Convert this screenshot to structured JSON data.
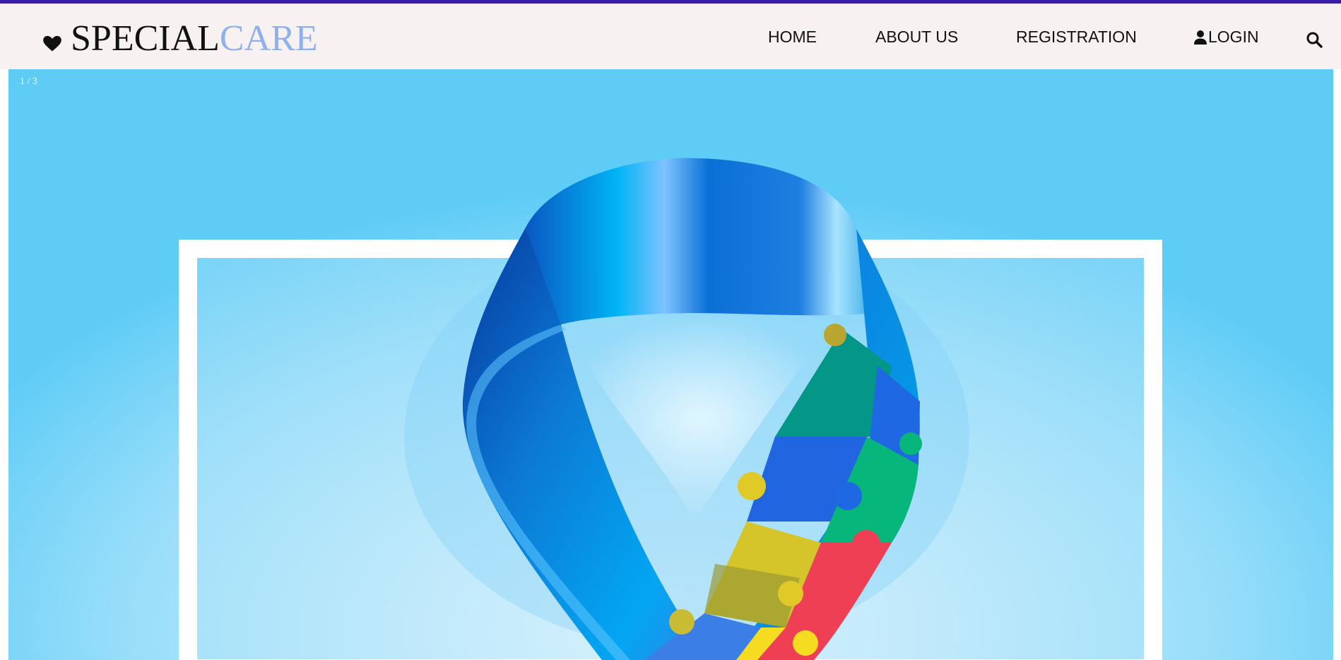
{
  "brand": {
    "part1": "SPECIAL",
    "part2": "CARE",
    "icon": "heart-icon"
  },
  "nav": {
    "home": "HOME",
    "about": "ABOUT US",
    "registration": "REGISTRATION",
    "login": "LOGIN",
    "login_icon": "user-icon",
    "search_icon": "search-icon"
  },
  "slider": {
    "counter": "1 / 3",
    "image": "autism-awareness-puzzle-ribbon"
  },
  "colors": {
    "top_border": "#3a1fa8",
    "navbar_bg": "#f7f2f1",
    "brand_accent": "#8fb0ef",
    "hero_sky": "#5fccf6"
  }
}
